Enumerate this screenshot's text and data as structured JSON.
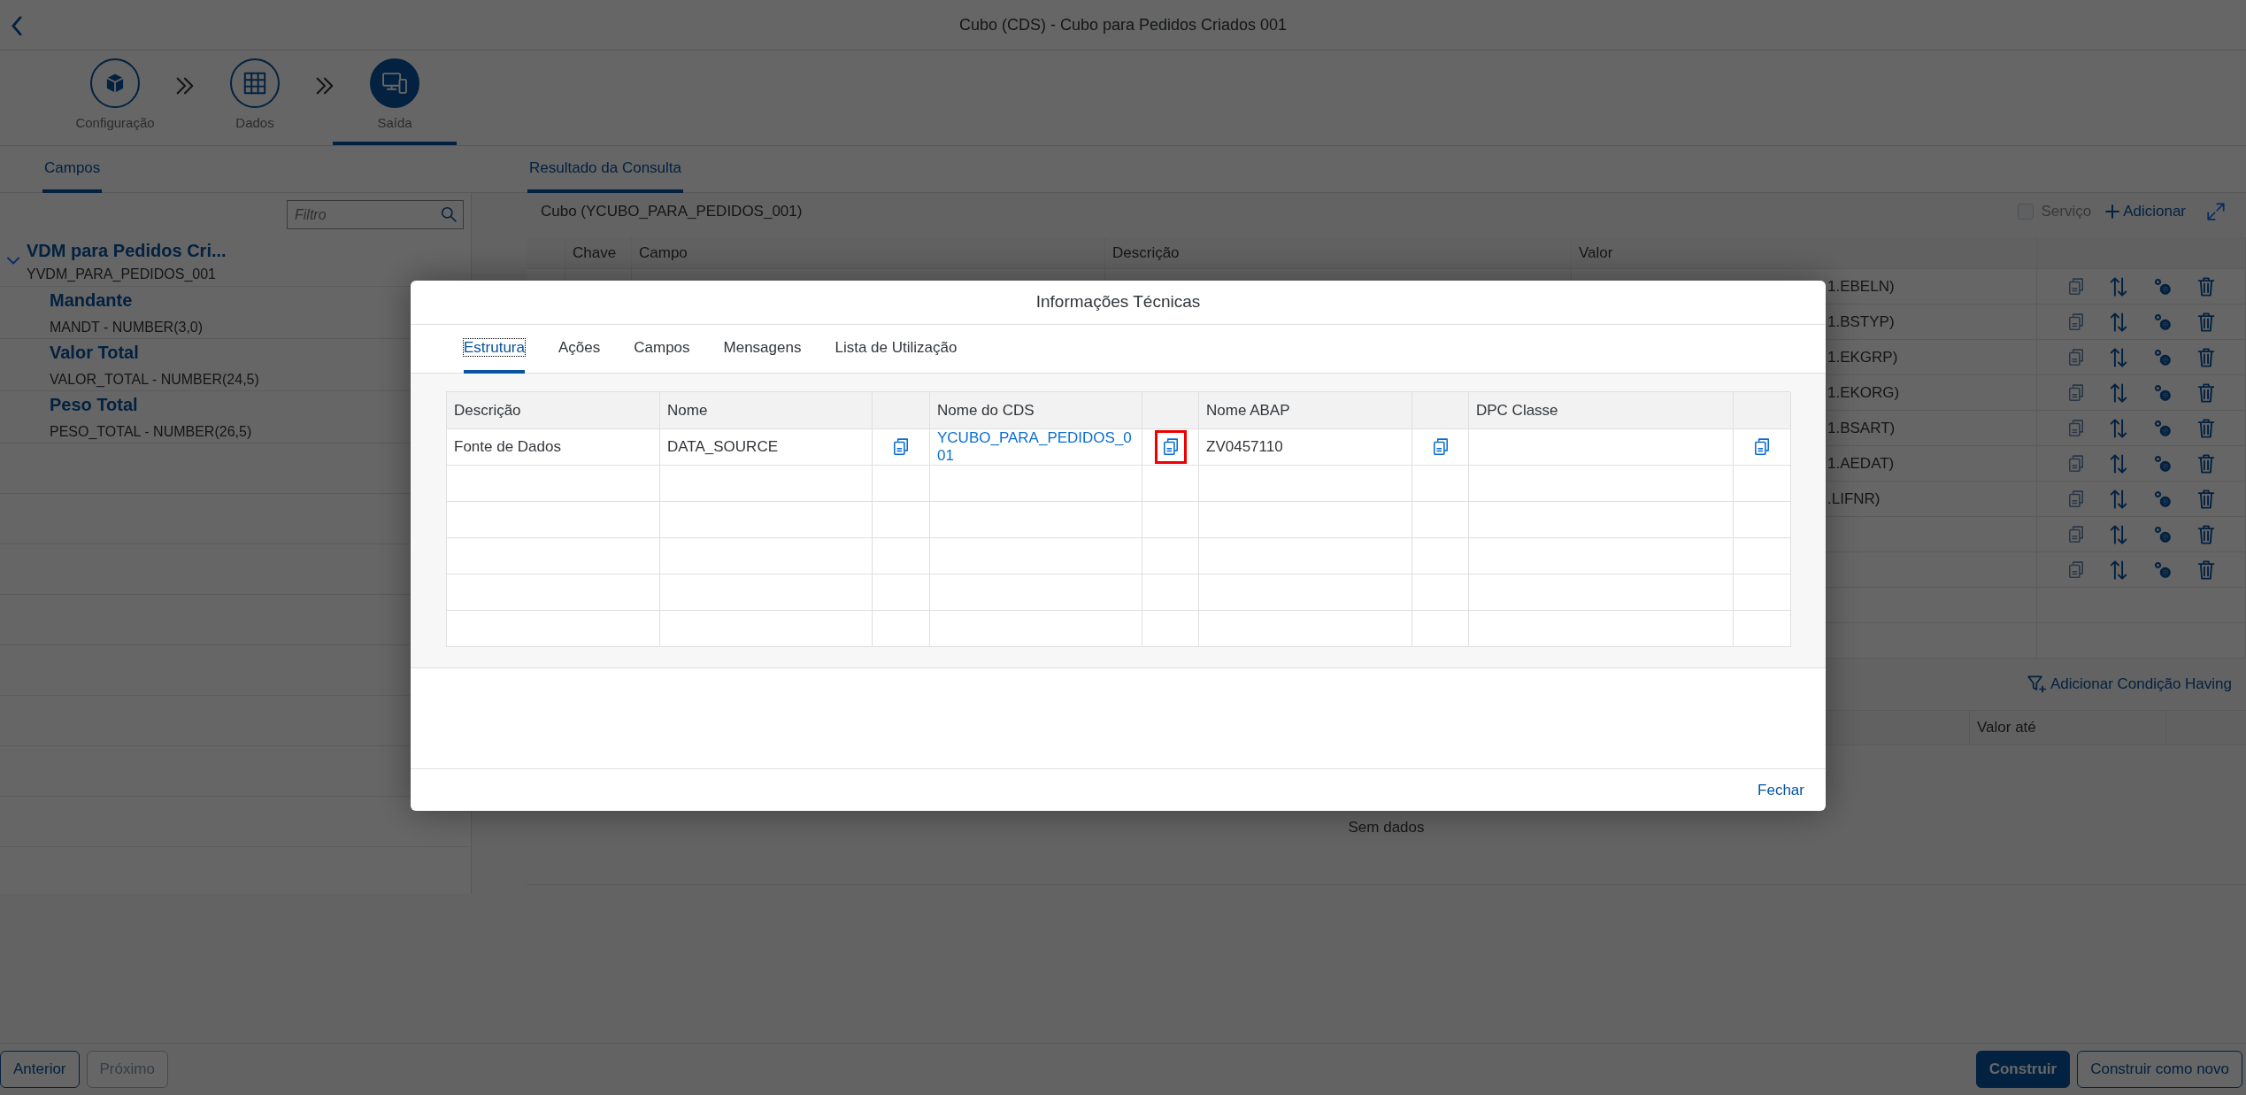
{
  "header": {
    "title": "Cubo (CDS) - Cubo para Pedidos Criados 001"
  },
  "steps": [
    {
      "label": "Configuração",
      "selected": false
    },
    {
      "label": "Dados",
      "selected": false
    },
    {
      "label": "Saída",
      "selected": true
    }
  ],
  "fields_panel": {
    "tab": {
      "label": "Campos",
      "selected": true
    },
    "filter": {
      "placeholder": "Filtro"
    },
    "tree": [
      {
        "title": "VDM para Pedidos Cri...",
        "subtitle": "YVDM_PARA_PEDIDOS_001",
        "expanded": true,
        "children": [
          {
            "title": "Mandante",
            "subtitle": "MANDT - NUMBER(3,0)"
          },
          {
            "title": "Valor Total",
            "subtitle": "VALOR_TOTAL - NUMBER(24,5)"
          },
          {
            "title": "Peso Total",
            "subtitle": "PESO_TOTAL - NUMBER(26,5)"
          }
        ]
      }
    ]
  },
  "result_panel": {
    "tab": {
      "label": "Resultado da Consulta",
      "selected": true
    },
    "title": "Cubo (YCUBO_PARA_PEDIDOS_001)",
    "service": {
      "label": "Serviço",
      "checked": false,
      "disabled": true
    },
    "add_button": "Adicionar",
    "columns": [
      "Chave",
      "Campo",
      "Descrição",
      "Valor"
    ],
    "rows": [
      {
        "value": "1.EBELN)",
        "copy_enabled": false
      },
      {
        "value": "1.BSTYP)",
        "copy_enabled": false
      },
      {
        "value": "1.EKGRP)",
        "copy_enabled": false
      },
      {
        "value": "1.EKORG)",
        "copy_enabled": false
      },
      {
        "value": "1.BSART)",
        "copy_enabled": false
      },
      {
        "value": "1.AEDAT)",
        "copy_enabled": false
      },
      {
        "value": ".LIFNR)",
        "copy_enabled": false
      },
      {
        "copy_enabled": false
      },
      {
        "copy_enabled": false
      }
    ],
    "having_button": "Adicionar Condição Having",
    "having_columns": [
      "Valor até"
    ],
    "empty_text": "Sem dados"
  },
  "footer": {
    "buttons": [
      {
        "label": "Anterior",
        "kind": "default",
        "disabled": false
      },
      {
        "label": "Próximo",
        "kind": "default",
        "disabled": true
      },
      {
        "label": "Construir",
        "kind": "primary",
        "disabled": false
      },
      {
        "label": "Construir como novo",
        "kind": "default",
        "disabled": false
      }
    ]
  },
  "dialog": {
    "title": "Informações Técnicas",
    "tabs": [
      {
        "label": "Estrutura",
        "selected": true
      },
      {
        "label": "Ações",
        "selected": false
      },
      {
        "label": "Campos",
        "selected": false
      },
      {
        "label": "Mensagens",
        "selected": false
      },
      {
        "label": "Lista de Utilização",
        "selected": false
      }
    ],
    "columns": [
      {
        "kind": "text",
        "label": "Descrição"
      },
      {
        "kind": "text",
        "label": "Nome"
      },
      {
        "kind": "icon"
      },
      {
        "kind": "text",
        "label": "Nome do CDS"
      },
      {
        "kind": "icon"
      },
      {
        "kind": "text",
        "label": "Nome ABAP"
      },
      {
        "kind": "icon"
      },
      {
        "kind": "text",
        "label": "DPC Classe"
      },
      {
        "kind": "icon"
      }
    ],
    "rows": [
      {
        "cells": [
          {
            "kind": "text",
            "text": "Fonte de Dados"
          },
          {
            "kind": "text",
            "text": "DATA_SOURCE"
          },
          {
            "kind": "copy",
            "highlighted": false
          },
          {
            "kind": "link",
            "text": "YCUBO_PARA_PEDIDOS_001"
          },
          {
            "kind": "copy",
            "highlighted": true
          },
          {
            "kind": "text",
            "text": "ZV0457110"
          },
          {
            "kind": "copy",
            "highlighted": false
          },
          {
            "kind": "empty"
          },
          {
            "kind": "copy",
            "highlighted": false
          }
        ]
      }
    ],
    "close_button": "Fechar"
  }
}
